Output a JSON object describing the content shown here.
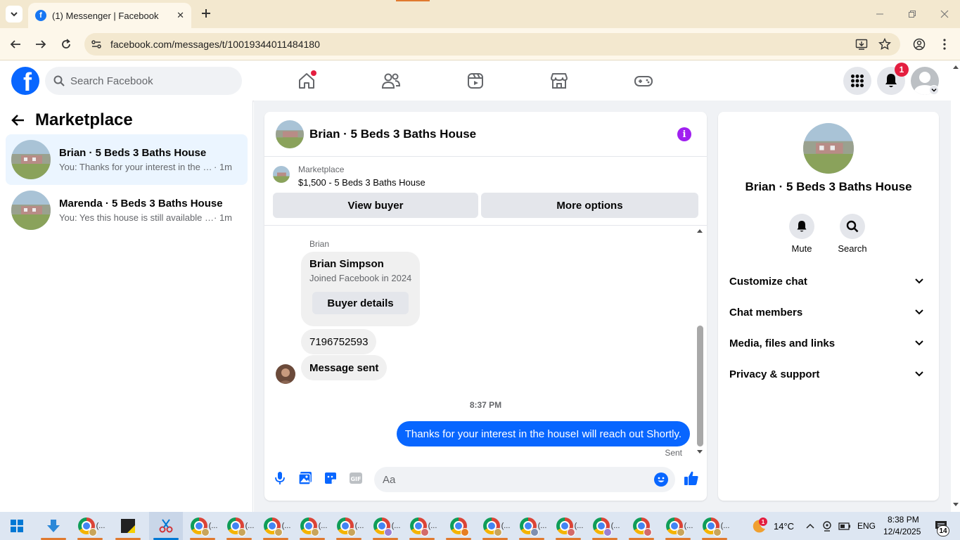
{
  "browser": {
    "tab_title": "(1) Messenger | Facebook",
    "url": "facebook.com/messages/t/10019344011484180"
  },
  "fb_header": {
    "search_placeholder": "Search Facebook",
    "notification_count": "1"
  },
  "left_panel": {
    "title": "Marketplace",
    "chats": [
      {
        "name": "Brian · 5 Beds 3 Baths House",
        "preview": "You: Thanks for your interest in the h...",
        "time": "· 1m",
        "active": true
      },
      {
        "name": "Marenda · 5 Beds 3 Baths House",
        "preview": "You: Yes this house is still available fo...",
        "time": "· 1m",
        "active": false
      }
    ]
  },
  "conversation": {
    "title": "Brian · 5 Beds 3 Baths House",
    "marketplace_label": "Marketplace",
    "listing": "$1,500 - 5 Beds 3 Baths House",
    "view_buyer": "View buyer",
    "more_options": "More options",
    "sender_label": "Brian",
    "card_name": "Brian Simpson",
    "card_joined": "Joined Facebook in 2024",
    "card_button": "Buyer details",
    "msg_phone": "7196752593",
    "msg_sent": "Message sent",
    "timestamp": "8:37 PM",
    "outgoing": "Thanks for your interest in the houseI will reach out Shortly.",
    "sent_status": "Sent",
    "composer_placeholder": "Aa"
  },
  "right_panel": {
    "name": "Brian · 5 Beds 3 Baths House",
    "mute": "Mute",
    "search": "Search",
    "rows": [
      "Customize chat",
      "Chat members",
      "Media, files and links",
      "Privacy & support"
    ]
  },
  "taskbar": {
    "weather_temp": "14°C",
    "weather_badge": "1",
    "language": "ENG",
    "time": "8:38 PM",
    "date": "12/4/2025",
    "notif_count": "14",
    "ellipsis": "(..."
  },
  "colors": {
    "fb_blue": "#0866ff",
    "brand_purple": "#a020f0",
    "badge_red": "#e41e3f",
    "taskbar_accent": "#e07a2f"
  }
}
